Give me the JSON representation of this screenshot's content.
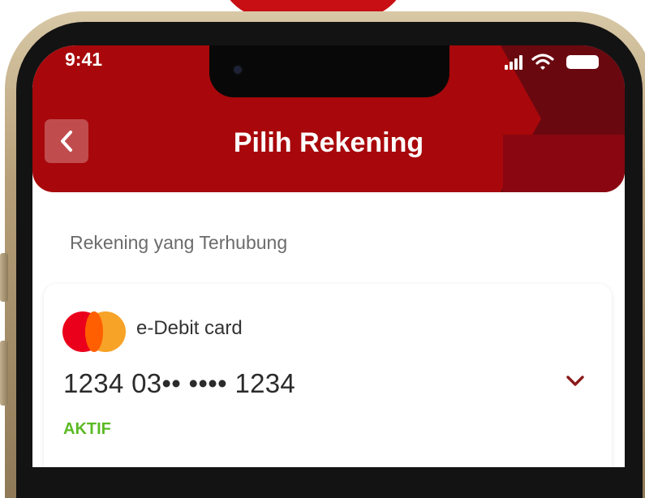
{
  "status_bar": {
    "time": "9:41"
  },
  "header": {
    "title": "Pilih Rekening",
    "back_icon": "chevron-left-icon"
  },
  "section": {
    "label": "Rekening yang Terhubung"
  },
  "card": {
    "brand_icon": "mastercard-logo",
    "type": "e-Debit card",
    "number": "1234 03•• •••• 1234",
    "status": "AKTIF",
    "expand_icon": "chevron-down-icon"
  },
  "colors": {
    "header_red": "#a8080b",
    "header_dark": "#6a0810",
    "status_green": "#5aba23",
    "chevron": "#8b1a1a"
  }
}
